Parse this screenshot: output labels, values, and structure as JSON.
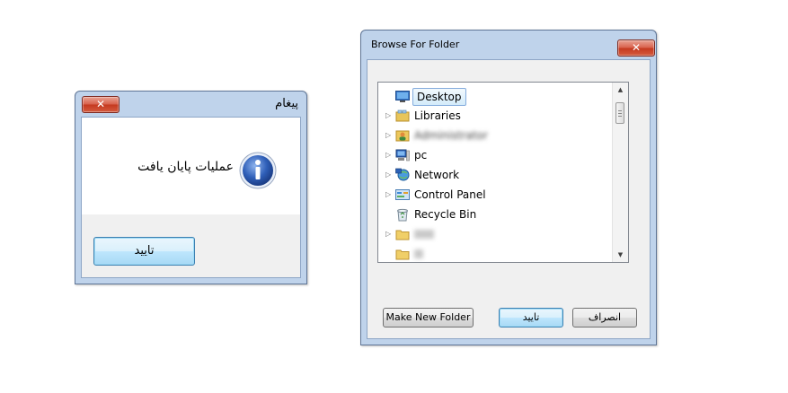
{
  "message_dialog": {
    "title": "پیغام",
    "close_glyph": "✕",
    "icon": "info-icon",
    "icon_glyph": "i",
    "message": "عملیات پایان یافت",
    "ok_label": "تایید"
  },
  "browse_dialog": {
    "title": "Browse For Folder",
    "close_glyph": "✕",
    "tree": [
      {
        "label": "Desktop",
        "icon": "desktop-icon",
        "expandable": false,
        "selected": true
      },
      {
        "label": "Libraries",
        "icon": "libraries-icon",
        "expandable": true
      },
      {
        "label": "Administrator",
        "icon": "user-folder-icon",
        "expandable": true,
        "obscured": true
      },
      {
        "label": "pc",
        "icon": "computer-icon",
        "expandable": true
      },
      {
        "label": "Network",
        "icon": "network-icon",
        "expandable": true
      },
      {
        "label": "Control Panel",
        "icon": "control-panel-icon",
        "expandable": true
      },
      {
        "label": "Recycle Bin",
        "icon": "recycle-bin-icon",
        "expandable": false
      },
      {
        "label": "",
        "icon": "folder-icon",
        "expandable": true,
        "obscured": true
      },
      {
        "label": "",
        "icon": "folder-icon",
        "expandable": false,
        "obscured": true
      }
    ],
    "make_new_folder_label": "Make New Folder",
    "ok_label": "تایید",
    "cancel_label": "انصراف",
    "arrow_right_glyph": "▷",
    "scroll_up_glyph": "▲",
    "scroll_down_glyph": "▼"
  },
  "colors": {
    "window_frame": "#bfd3eb",
    "close_button": "#c5391f",
    "selection": "#d3ebfa",
    "info_icon": "#2f5fb8"
  }
}
